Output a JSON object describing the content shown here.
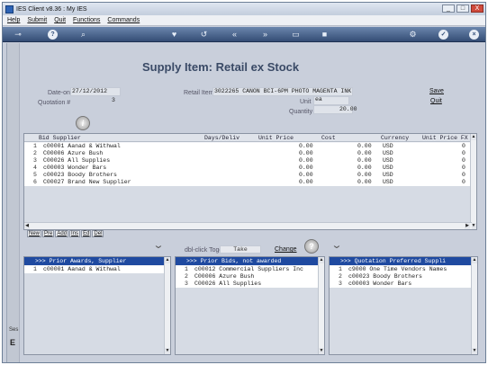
{
  "window": {
    "title": "IES Client v8.36 : My IES",
    "minimize": "_",
    "maximize": "□",
    "close": "X"
  },
  "menu": {
    "items": [
      "Help",
      "Submit",
      "Quit",
      "Functions",
      "Commands"
    ]
  },
  "toolbar": {
    "icons": [
      "key-icon",
      "help-icon",
      "search-icon",
      "heart-icon",
      "refresh-icon",
      "rewind-icon",
      "forward-icon",
      "window-icon",
      "stop-icon",
      "settings-icon",
      "ok-icon",
      "close-icon"
    ]
  },
  "header": {
    "title": "Supply Item: Retail ex Stock",
    "date_on_label": "Date-on",
    "date_on_value": "27/12/2012",
    "quotation_label": "Quotation #",
    "quotation_value": "3",
    "retail_item_label": "Retail Item",
    "retail_item_value": "3022265 CANON BCI-6PM PHOTO MAGENTA INK",
    "unit_label": "Unit",
    "unit_value": "ea",
    "quantity_label": "Quantity",
    "quantity_value": "20.00",
    "save_link": "Save",
    "quit_link": "Quit"
  },
  "bid_grid": {
    "columns": [
      "Bid Supplier",
      "Days/Deliv",
      "Unit Price",
      "Cost",
      "Currency",
      "Unit Price FX"
    ],
    "rows": [
      {
        "n": "1",
        "supplier": "c00001 Aanad & Withwal",
        "unit_price": "0.00",
        "cost": "0.00",
        "currency": "USD",
        "fx": "0"
      },
      {
        "n": "2",
        "supplier": "C00006 Azure Bush",
        "unit_price": "0.00",
        "cost": "0.00",
        "currency": "USD",
        "fx": "0"
      },
      {
        "n": "3",
        "supplier": "C00026 All Supplies",
        "unit_price": "0.00",
        "cost": "0.00",
        "currency": "USD",
        "fx": "0"
      },
      {
        "n": "4",
        "supplier": "c00003 Wonder Bars",
        "unit_price": "0.00",
        "cost": "0.00",
        "currency": "USD",
        "fx": "0"
      },
      {
        "n": "5",
        "supplier": "c00023 Boody Brothers",
        "unit_price": "0.00",
        "cost": "0.00",
        "currency": "USD",
        "fx": "0"
      },
      {
        "n": "6",
        "supplier": "C00027 Brand New Supplier",
        "unit_price": "0.00",
        "cost": "0.00",
        "currency": "USD",
        "fx": "0"
      }
    ]
  },
  "grid_buttons": [
    "New",
    "Pre",
    "Add",
    "Ins",
    "Ed",
    "Del"
  ],
  "toggle": {
    "dbl_click_label": "dbl-click Toggle",
    "take_value": "Take",
    "change_link": "Change"
  },
  "prior_awards": {
    "title": ">>> Prior Awards, Supplier",
    "rows": [
      {
        "n": "1",
        "text": "c00001 Aanad & Withwal"
      }
    ]
  },
  "prior_bids": {
    "title": ">>> Prior Bids, not awarded",
    "rows": [
      {
        "n": "1",
        "text": "c00012 Commercial Suppliers Inc"
      },
      {
        "n": "2",
        "text": "C00006 Azure Bush"
      },
      {
        "n": "3",
        "text": "C00026 All Supplies"
      }
    ]
  },
  "preferred": {
    "title": ">>> Quotation Preferred Suppli",
    "rows": [
      {
        "n": "1",
        "text": "c9000 One Time Vendors Names"
      },
      {
        "n": "2",
        "text": "c00023 Boody Brothers"
      },
      {
        "n": "3",
        "text": "c00003 Wonder Bars"
      }
    ]
  },
  "left_strip": {
    "label": "Ses",
    "mark": "E"
  }
}
